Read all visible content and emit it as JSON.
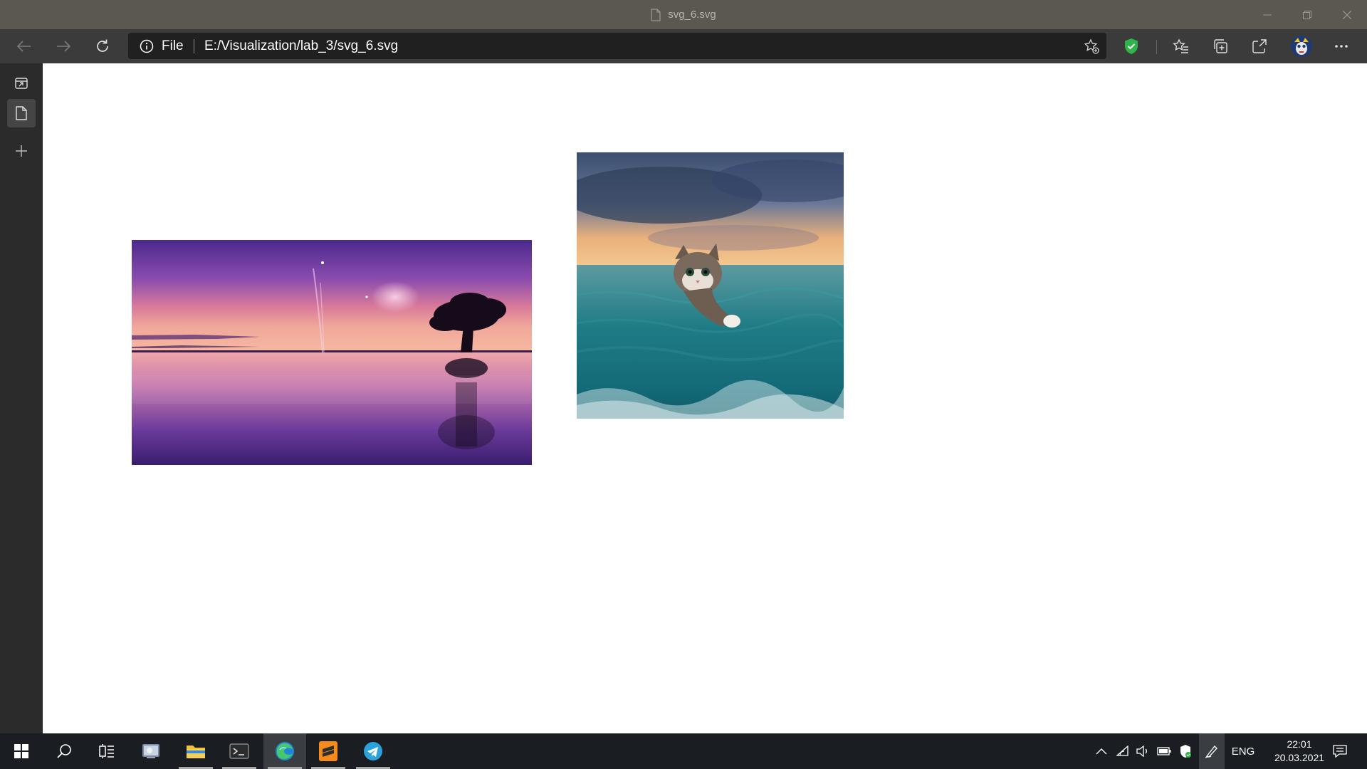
{
  "window": {
    "title": "svg_6.svg",
    "controls": [
      "minimize",
      "restore",
      "close"
    ]
  },
  "navbar": {
    "back_icon": "arrow-left-icon",
    "forward_icon": "arrow-right-icon",
    "refresh_icon": "refresh-icon",
    "address": {
      "scheme_label": "File",
      "url": "E:/Visualization/lab_3/svg_6.svg"
    },
    "toolbar_icons": [
      "add-favorite-icon",
      "shield-extension-icon",
      "favorites-icon",
      "collections-icon",
      "share-icon",
      "profile-avatar",
      "more-icon"
    ]
  },
  "sidebar": {
    "items": [
      "tab-actions-icon",
      "page-tab-icon",
      "new-tab-icon"
    ]
  },
  "content": {
    "images": [
      {
        "description": "purple sunset lake with tree",
        "name": "sunset-lake-image"
      },
      {
        "description": "kitten in ocean waves",
        "name": "kitten-ocean-image"
      }
    ]
  },
  "taskbar": {
    "apps": [
      "start-icon",
      "search-icon",
      "task-view-icon",
      "app-icon",
      "file-explorer-icon",
      "terminal-icon",
      "edge-icon",
      "sublime-text-icon",
      "telegram-icon"
    ],
    "language": "ENG",
    "time": "22:01",
    "date": "20.03.2021"
  },
  "colors": {
    "titlebar": "#5b5751",
    "navbar": "#3b3b3b",
    "address_bg": "#202020",
    "sidebar": "#2b2b2b",
    "taskbar": "#1a1d22",
    "shield_green": "#2fb34a"
  }
}
